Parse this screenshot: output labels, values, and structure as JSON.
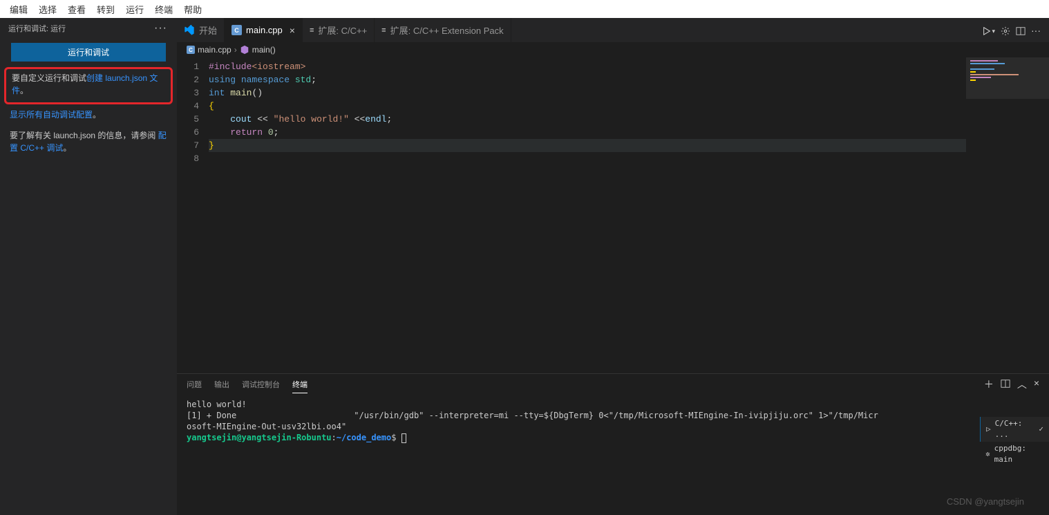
{
  "menubar": [
    "编辑",
    "选择",
    "查看",
    "转到",
    "运行",
    "终端",
    "帮助"
  ],
  "sidebar": {
    "title": "运行和调试: 运行",
    "run_button": "运行和调试",
    "launch_text1": "要自定义运行和调试",
    "launch_link": "创建 launch.json 文件",
    "launch_text2": "。",
    "show_all_link": "显示所有自动调试配置",
    "show_all_dot": "。",
    "help_text1": "要了解有关 launch.json 的信息，请参阅 ",
    "help_link": "配置 C/C++ 调试",
    "help_text2": "。"
  },
  "tabs": [
    {
      "label": "开始",
      "type": "welcome"
    },
    {
      "label": "main.cpp",
      "type": "cpp",
      "active": true,
      "close": true
    },
    {
      "label": "扩展: C/C++",
      "type": "ext"
    },
    {
      "label": "扩展: C/C++ Extension Pack",
      "type": "ext"
    }
  ],
  "breadcrumb": {
    "file": "main.cpp",
    "symbol": "main()"
  },
  "code": {
    "lines": [
      {
        "n": 1,
        "tokens": [
          [
            "#include",
            "k-purple"
          ],
          [
            "<iostream>",
            "k-str"
          ]
        ]
      },
      {
        "n": 2,
        "tokens": [
          [
            "using ",
            "k-blue"
          ],
          [
            "namespace ",
            "k-blue"
          ],
          [
            "std",
            "k-type"
          ],
          [
            ";",
            "k-def"
          ]
        ]
      },
      {
        "n": 3,
        "tokens": [
          [
            "",
            "k-def"
          ]
        ]
      },
      {
        "n": 4,
        "tokens": [
          [
            "int ",
            "k-blue"
          ],
          [
            "main",
            "k-fn"
          ],
          [
            "()",
            "k-def"
          ]
        ]
      },
      {
        "n": 5,
        "tokens": [
          [
            "{",
            "k-gold"
          ]
        ]
      },
      {
        "n": 6,
        "tokens": [
          [
            "    ",
            "k-def"
          ],
          [
            "cout",
            "k-var"
          ],
          [
            " << ",
            "k-def"
          ],
          [
            "\"hello world!\"",
            "k-str"
          ],
          [
            " <<",
            "k-def"
          ],
          [
            "endl",
            "k-var"
          ],
          [
            ";",
            "k-def"
          ]
        ]
      },
      {
        "n": 7,
        "tokens": [
          [
            "    ",
            "k-def"
          ],
          [
            "return ",
            "k-purple"
          ],
          [
            "0",
            "k-num"
          ],
          [
            ";",
            "k-def"
          ]
        ]
      },
      {
        "n": 8,
        "tokens": [
          [
            "}",
            "k-gold"
          ]
        ],
        "hl": true
      }
    ]
  },
  "panel": {
    "tabs": [
      "问题",
      "输出",
      "调试控制台",
      "终端"
    ],
    "active": 3
  },
  "terminal": {
    "line1": "hello world!",
    "line2a": "[1] + Done",
    "line2b": "\"/usr/bin/gdb\" --interpreter=mi --tty=${DbgTerm} 0<\"/tmp/Microsoft-MIEngine-In-ivipjiju.orc\" 1>\"/tmp/Micr",
    "line3": "osoft-MIEngine-Out-usv32lbi.oo4\"",
    "prompt_user": "yangtsejin@yangtsejin-Robuntu",
    "prompt_sep": ":",
    "prompt_path": "~/code_demo",
    "prompt_end": "$",
    "side": [
      {
        "icon": "▷",
        "label": "C/C++: ...",
        "extra": "✓",
        "active": true
      },
      {
        "icon": "✲",
        "label": "cppdbg: main"
      }
    ]
  },
  "watermark": "CSDN @yangtsejin"
}
